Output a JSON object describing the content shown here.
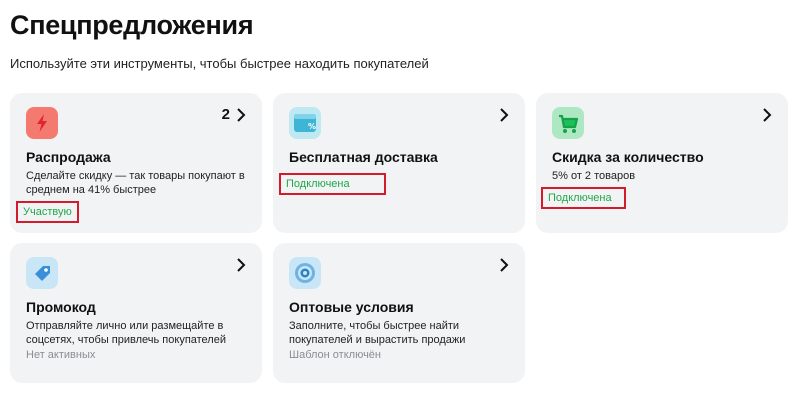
{
  "header": {
    "title": "Спецпредложения",
    "subtitle": "Используйте эти инструменты, чтобы быстрее находить покупателей"
  },
  "cards": [
    {
      "title": "Распродажа",
      "description": "Сделайте скидку — так товары покупают в среднем на 41% быстрее",
      "status": "Участвую",
      "count": "2",
      "icon": "lightning-icon",
      "accent": "#f05a4f"
    },
    {
      "title": "Бесплатная доставка",
      "description": "",
      "status": "Подключена",
      "icon": "delivery-discount-icon",
      "accent": "#3fb5d6"
    },
    {
      "title": "Скидка за количество",
      "description": "5% от 2 товаров",
      "status": "Подключена",
      "icon": "cart-icon",
      "accent": "#1fbf5a"
    },
    {
      "title": "Промокод",
      "description": "Отправляйте лично или размещайте в соцсетях, чтобы привлечь покупателей",
      "status": "Нет активных",
      "icon": "tag-icon",
      "accent": "#3a8fd8"
    },
    {
      "title": "Оптовые условия",
      "description": "Заполните, чтобы быстрее найти покупателей и вырастить продажи",
      "status": "Шаблон отключён",
      "icon": "target-icon",
      "accent": "#3a8fd8"
    }
  ],
  "colors": {
    "status_active": "#1fa848",
    "status_inactive": "#8b8d91",
    "highlight_box": "#d21c2b",
    "card_background": "#f2f3f5"
  }
}
